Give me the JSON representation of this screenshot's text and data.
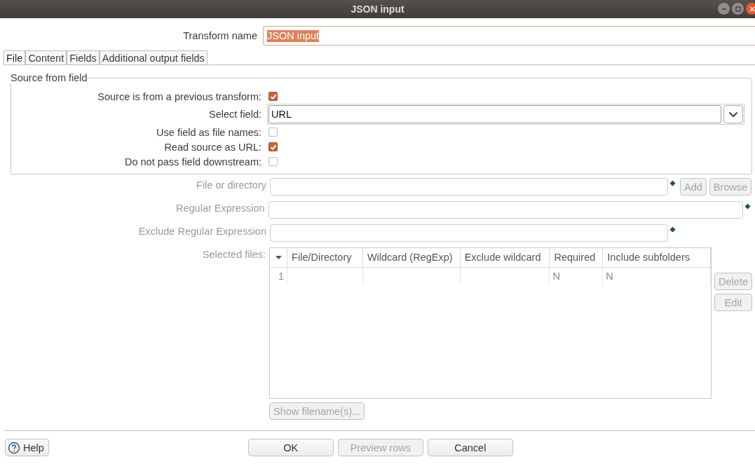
{
  "window": {
    "title": "JSON input"
  },
  "transform_name": {
    "label": "Transform name",
    "value": "JSON input"
  },
  "tabs": [
    {
      "label": "File",
      "selected": true
    },
    {
      "label": "Content",
      "selected": false
    },
    {
      "label": "Fields",
      "selected": false
    },
    {
      "label": "Additional output fields",
      "selected": false
    }
  ],
  "source_group": {
    "title": "Source from field",
    "rows": [
      {
        "kind": "checkbox",
        "label": "Source is from a previous transform:",
        "checked": true
      },
      {
        "kind": "select",
        "label": "Select field:",
        "value": "URL"
      },
      {
        "kind": "checkbox",
        "label": "Use field as file names:",
        "checked": false
      },
      {
        "kind": "checkbox",
        "label": "Read source as URL:",
        "checked": true
      },
      {
        "kind": "checkbox",
        "label": "Do not pass field downstream:",
        "checked": false
      }
    ]
  },
  "file_rows": [
    {
      "label": "File or directory",
      "disabled": true,
      "buttons": [
        {
          "label": "Add",
          "disabled": true
        },
        {
          "label": "Browse",
          "disabled": true
        }
      ]
    },
    {
      "label": "Regular Expression",
      "disabled": true,
      "buttons": []
    },
    {
      "label": "Exclude Regular Expression",
      "disabled": true,
      "buttons": []
    }
  ],
  "selected_files": {
    "label": "Selected files:",
    "disabled": true,
    "columns": [
      "File/Directory",
      "Wildcard (RegExp)",
      "Exclude wildcard",
      "Required",
      "Include subfolders"
    ],
    "rows": [
      {
        "number": "1",
        "cells": [
          "",
          "",
          "",
          "N",
          "N"
        ]
      }
    ],
    "side_buttons": [
      {
        "label": "Delete",
        "disabled": true
      },
      {
        "label": "Edit",
        "disabled": true
      }
    ],
    "show_button": {
      "label": "Show filename(s)...",
      "disabled": true
    }
  },
  "footer": {
    "help": {
      "label": "Help",
      "disabled": false
    },
    "buttons": [
      {
        "label": "OK",
        "disabled": false
      },
      {
        "label": "Preview rows",
        "disabled": true
      },
      {
        "label": "Cancel",
        "disabled": false
      }
    ]
  }
}
